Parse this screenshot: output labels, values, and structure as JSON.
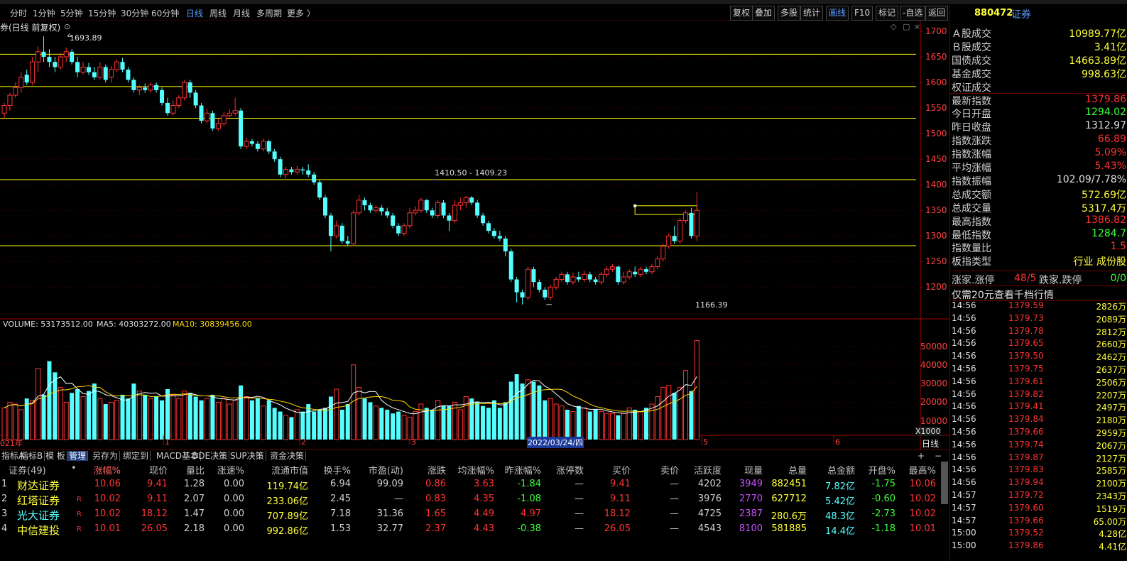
{
  "toolbar": {
    "periods": [
      "分时",
      "1分钟",
      "5分钟",
      "15分钟",
      "30分钟",
      "60分钟",
      "日线",
      "周线",
      "月线",
      "多周期",
      "更多 〉"
    ],
    "active_period": "日线",
    "right_buttons": [
      "复权",
      "叠加",
      "多股",
      "统计",
      "画线",
      "F10",
      "标记",
      "-自选",
      "返回"
    ],
    "active_right": "画线"
  },
  "chart": {
    "title": "券(日线 前复权)",
    "high_label": "1693.89",
    "low_label": "1166.39",
    "range_label": "1410.50 - 1409.23",
    "price_ticks": [
      "1700",
      "1650",
      "1600",
      "1550",
      "1500",
      "1450",
      "1400",
      "1350",
      "1300",
      "1250",
      "1200"
    ],
    "volume_title": "VOLUME: 53173512.00",
    "ma5_label": "MA5: 40303272.00",
    "ma10_label": "MA10: 30839456.00",
    "vol_ticks": [
      "50000",
      "40000",
      "30000",
      "20000",
      "10000"
    ],
    "vol_unit": "X1000",
    "x_labels": [
      "021年",
      "1",
      "2",
      "3",
      "5",
      "6"
    ],
    "cursor_date": "2022/03/24/四",
    "period_tag": "日线",
    "colors": {
      "up": "#ff3232",
      "down": "#54ffff",
      "support": "#ffff00",
      "ma5": "#ffffff",
      "ma10": "#ffd800"
    }
  },
  "chart_data": {
    "type": "candlestick",
    "title": "券(日线 前复权)",
    "support_lines": [
      1655,
      1592,
      1530,
      1410,
      1281
    ],
    "candles": [
      [
        1540,
        1555,
        1530,
        1560
      ],
      [
        1555,
        1575,
        1545,
        1580
      ],
      [
        1575,
        1590,
        1570,
        1600
      ],
      [
        1590,
        1610,
        1580,
        1620
      ],
      [
        1615,
        1600,
        1595,
        1625
      ],
      [
        1600,
        1640,
        1595,
        1650
      ],
      [
        1640,
        1660,
        1620,
        1670
      ],
      [
        1660,
        1650,
        1640,
        1690
      ],
      [
        1650,
        1640,
        1630,
        1665
      ],
      [
        1640,
        1630,
        1620,
        1650
      ],
      [
        1630,
        1650,
        1625,
        1658
      ],
      [
        1650,
        1660,
        1640,
        1668
      ],
      [
        1660,
        1640,
        1635,
        1665
      ],
      [
        1640,
        1620,
        1610,
        1650
      ],
      [
        1620,
        1630,
        1615,
        1640
      ],
      [
        1630,
        1620,
        1615,
        1638
      ],
      [
        1620,
        1610,
        1605,
        1630
      ],
      [
        1610,
        1630,
        1605,
        1640
      ],
      [
        1630,
        1605,
        1600,
        1635
      ],
      [
        1610,
        1625,
        1600,
        1632
      ],
      [
        1625,
        1640,
        1620,
        1645
      ],
      [
        1640,
        1625,
        1620,
        1648
      ],
      [
        1625,
        1605,
        1600,
        1630
      ],
      [
        1605,
        1585,
        1580,
        1610
      ],
      [
        1585,
        1590,
        1575,
        1595
      ],
      [
        1590,
        1585,
        1580,
        1598
      ],
      [
        1585,
        1595,
        1580,
        1600
      ],
      [
        1595,
        1585,
        1580,
        1600
      ],
      [
        1585,
        1560,
        1555,
        1590
      ],
      [
        1560,
        1540,
        1535,
        1570
      ],
      [
        1540,
        1555,
        1535,
        1565
      ],
      [
        1555,
        1570,
        1550,
        1575
      ],
      [
        1570,
        1600,
        1565,
        1605
      ],
      [
        1600,
        1580,
        1570,
        1605
      ],
      [
        1580,
        1555,
        1550,
        1585
      ],
      [
        1555,
        1525,
        1520,
        1560
      ],
      [
        1525,
        1540,
        1520,
        1548
      ],
      [
        1540,
        1510,
        1505,
        1545
      ],
      [
        1510,
        1520,
        1505,
        1530
      ],
      [
        1520,
        1535,
        1515,
        1542
      ],
      [
        1535,
        1540,
        1530,
        1548
      ],
      [
        1540,
        1545,
        1535,
        1570
      ],
      [
        1545,
        1475,
        1470,
        1550
      ],
      [
        1475,
        1485,
        1470,
        1492
      ],
      [
        1485,
        1480,
        1475,
        1490
      ],
      [
        1480,
        1470,
        1465,
        1485
      ],
      [
        1470,
        1485,
        1465,
        1490
      ],
      [
        1485,
        1465,
        1460,
        1488
      ],
      [
        1465,
        1450,
        1445,
        1470
      ],
      [
        1450,
        1420,
        1415,
        1455
      ],
      [
        1420,
        1430,
        1412,
        1435
      ],
      [
        1430,
        1425,
        1420,
        1435
      ],
      [
        1425,
        1430,
        1420,
        1438
      ],
      [
        1430,
        1428,
        1420,
        1435
      ],
      [
        1428,
        1420,
        1415,
        1440
      ],
      [
        1420,
        1405,
        1400,
        1425
      ],
      [
        1405,
        1375,
        1370,
        1410
      ],
      [
        1375,
        1340,
        1335,
        1380
      ],
      [
        1340,
        1300,
        1270,
        1345
      ],
      [
        1300,
        1320,
        1295,
        1330
      ],
      [
        1320,
        1290,
        1285,
        1325
      ],
      [
        1290,
        1285,
        1280,
        1300
      ],
      [
        1285,
        1345,
        1280,
        1350
      ],
      [
        1345,
        1370,
        1340,
        1380
      ],
      [
        1370,
        1360,
        1350,
        1375
      ],
      [
        1360,
        1350,
        1345,
        1365
      ],
      [
        1350,
        1355,
        1345,
        1360
      ],
      [
        1355,
        1348,
        1340,
        1360
      ],
      [
        1348,
        1340,
        1335,
        1355
      ],
      [
        1340,
        1320,
        1315,
        1345
      ],
      [
        1320,
        1305,
        1300,
        1325
      ],
      [
        1305,
        1320,
        1300,
        1325
      ],
      [
        1320,
        1345,
        1315,
        1355
      ],
      [
        1345,
        1350,
        1340,
        1358
      ],
      [
        1350,
        1370,
        1345,
        1375
      ],
      [
        1370,
        1350,
        1345,
        1372
      ],
      [
        1350,
        1340,
        1335,
        1355
      ],
      [
        1340,
        1365,
        1335,
        1370
      ],
      [
        1365,
        1340,
        1335,
        1370
      ],
      [
        1340,
        1330,
        1310,
        1345
      ],
      [
        1330,
        1360,
        1325,
        1370
      ],
      [
        1360,
        1365,
        1350,
        1375
      ],
      [
        1365,
        1375,
        1355,
        1378
      ],
      [
        1375,
        1365,
        1360,
        1378
      ],
      [
        1365,
        1340,
        1335,
        1370
      ],
      [
        1340,
        1325,
        1320,
        1345
      ],
      [
        1325,
        1310,
        1305,
        1330
      ],
      [
        1310,
        1300,
        1295,
        1315
      ],
      [
        1300,
        1295,
        1290,
        1310
      ],
      [
        1295,
        1270,
        1260,
        1300
      ],
      [
        1270,
        1215,
        1210,
        1275
      ],
      [
        1215,
        1190,
        1170,
        1220
      ],
      [
        1190,
        1180,
        1166,
        1195
      ],
      [
        1180,
        1235,
        1175,
        1240
      ],
      [
        1235,
        1210,
        1200,
        1240
      ],
      [
        1210,
        1195,
        1190,
        1215
      ],
      [
        1195,
        1180,
        1175,
        1200
      ],
      [
        1180,
        1200,
        1175,
        1205
      ],
      [
        1200,
        1215,
        1195,
        1220
      ],
      [
        1215,
        1225,
        1210,
        1230
      ],
      [
        1225,
        1210,
        1205,
        1230
      ],
      [
        1210,
        1220,
        1205,
        1228
      ],
      [
        1220,
        1215,
        1210,
        1230
      ],
      [
        1215,
        1225,
        1210,
        1232
      ],
      [
        1225,
        1215,
        1210,
        1230
      ],
      [
        1215,
        1210,
        1205,
        1220
      ],
      [
        1210,
        1225,
        1205,
        1230
      ],
      [
        1225,
        1235,
        1220,
        1240
      ],
      [
        1235,
        1240,
        1230,
        1245
      ],
      [
        1240,
        1210,
        1205,
        1242
      ],
      [
        1210,
        1220,
        1205,
        1230
      ],
      [
        1220,
        1230,
        1215,
        1235
      ],
      [
        1230,
        1225,
        1220,
        1240
      ],
      [
        1225,
        1235,
        1220,
        1240
      ],
      [
        1235,
        1230,
        1225,
        1240
      ],
      [
        1230,
        1240,
        1225,
        1245
      ],
      [
        1240,
        1255,
        1235,
        1260
      ],
      [
        1255,
        1280,
        1250,
        1285
      ],
      [
        1280,
        1300,
        1275,
        1305
      ],
      [
        1300,
        1290,
        1285,
        1320
      ],
      [
        1290,
        1330,
        1285,
        1335
      ],
      [
        1330,
        1345,
        1325,
        1350
      ],
      [
        1345,
        1300,
        1295,
        1355
      ],
      [
        1300,
        1350,
        1290,
        1386
      ]
    ],
    "volumes": [
      17,
      20,
      19,
      16,
      22,
      21,
      38,
      24,
      42,
      36,
      28,
      20,
      25,
      27,
      23,
      26,
      30,
      22,
      19,
      20,
      21,
      24,
      22,
      30,
      26,
      24,
      22,
      23,
      21,
      27,
      24,
      22,
      26,
      25,
      23,
      21,
      22,
      24,
      20,
      22,
      19,
      21,
      29,
      23,
      21,
      22,
      18,
      21,
      17,
      15,
      13,
      12,
      16,
      15,
      19,
      15,
      16,
      17,
      23,
      27,
      16,
      19,
      40,
      28,
      22,
      20,
      18,
      17,
      16,
      14,
      15,
      13,
      12,
      15,
      19,
      17,
      16,
      21,
      18,
      18,
      20,
      16,
      23,
      22,
      20,
      18,
      17,
      21,
      17,
      20,
      31,
      35,
      30,
      32,
      31,
      29,
      21,
      22,
      19,
      18,
      16,
      15,
      18,
      17,
      15,
      16,
      15,
      14,
      14,
      13,
      14,
      17,
      16,
      15,
      17,
      19,
      23,
      28,
      29,
      25,
      28,
      37,
      26,
      53
    ]
  },
  "tabs": [
    "指标A",
    "指标B",
    "模 板",
    "管理",
    "另存为",
    "绑定到",
    "MACD基本",
    "DDE决策",
    "SUP决策",
    "资金决策"
  ],
  "active_tab": "管理",
  "table": {
    "headers": [
      "证券(49)",
      "•",
      "涨幅%",
      "现价",
      "量比",
      "涨速%",
      "流通市值",
      "换手%",
      "市盈(动)",
      "涨跌",
      "均涨幅%",
      "昨涨幅%",
      "涨停数",
      "买价",
      "卖价",
      "活跃度",
      "现量",
      "总量",
      "总金额",
      "开盘%",
      "最高%"
    ],
    "rows": [
      {
        "n": "1",
        "name": "财达证券",
        "flag": "",
        "v": [
          "10.06",
          "9.41",
          "1.28",
          "0.00",
          "119.74亿",
          "6.94",
          "99.09",
          "0.86",
          "3.63",
          "-1.84",
          "—",
          "9.41",
          "—",
          "4202",
          "3949",
          "882451",
          "7.82亿",
          "-1.75",
          "10.06"
        ],
        "name_color": "#ffff3a"
      },
      {
        "n": "2",
        "name": "红塔证券",
        "flag": "R",
        "v": [
          "10.02",
          "9.11",
          "2.07",
          "0.00",
          "233.06亿",
          "2.45",
          "—",
          "0.83",
          "4.35",
          "-1.08",
          "—",
          "9.11",
          "—",
          "3976",
          "2770",
          "627712",
          "5.42亿",
          "-0.60",
          "10.02"
        ],
        "name_color": "#ffff3a"
      },
      {
        "n": "3",
        "name": "光大证券",
        "flag": "R",
        "v": [
          "10.02",
          "18.12",
          "1.47",
          "0.00",
          "707.89亿",
          "7.18",
          "31.36",
          "1.65",
          "4.49",
          "4.97",
          "—",
          "18.12",
          "—",
          "4725",
          "2387",
          "280.6万",
          "48.3亿",
          "-2.73",
          "10.02"
        ],
        "name_color": "#54ffff"
      },
      {
        "n": "4",
        "name": "中信建投",
        "flag": "R",
        "v": [
          "10.01",
          "26.05",
          "2.18",
          "0.00",
          "992.86亿",
          "1.53",
          "32.77",
          "2.37",
          "4.43",
          "-0.38",
          "—",
          "26.05",
          "—",
          "4543",
          "8100",
          "581885",
          "14.4亿",
          "-1.18",
          "10.01"
        ],
        "name_color": "#ffff3a"
      }
    ]
  },
  "right_panel": {
    "code": "880472",
    "name": "证券",
    "stats": [
      {
        "k": "Ａ股成交",
        "v": "10989.77亿",
        "c": "#ffff3a"
      },
      {
        "k": "Ｂ股成交",
        "v": "3.41亿",
        "c": "#ffff3a"
      },
      {
        "k": "国债成交",
        "v": "14663.89亿",
        "c": "#ffff3a"
      },
      {
        "k": "基金成交",
        "v": "998.63亿",
        "c": "#ffff3a"
      },
      {
        "k": "权证成交",
        "v": "",
        "c": "#ffff3a"
      },
      {
        "k": "最新指数",
        "v": "1379.86",
        "c": "#ff3232"
      },
      {
        "k": "今日开盘",
        "v": "1294.02",
        "c": "#3aff3a"
      },
      {
        "k": "昨日收盘",
        "v": "1312.97",
        "c": "#e0e0e0"
      },
      {
        "k": "指数涨跌",
        "v": "66.89",
        "c": "#ff3232"
      },
      {
        "k": "指数涨幅",
        "v": "5.09%",
        "c": "#ff3232"
      },
      {
        "k": "平均涨幅",
        "v": "5.43%",
        "c": "#ff3232"
      },
      {
        "k": "指数振幅",
        "v": "102.09/7.78%",
        "c": "#e0e0e0"
      },
      {
        "k": "总成交额",
        "v": "572.69亿",
        "c": "#ffff3a"
      },
      {
        "k": "总成交量",
        "v": "5317.4万",
        "c": "#ffff3a"
      },
      {
        "k": "最高指数",
        "v": "1386.82",
        "c": "#ff3232"
      },
      {
        "k": "最低指数",
        "v": "1284.7",
        "c": "#3aff3a"
      },
      {
        "k": "指数量比",
        "v": "1.5",
        "c": "#ff3232"
      },
      {
        "k": "板指类型",
        "v": "行业 成份股",
        "c": "#ffff3a"
      }
    ],
    "up_label": "涨家.涨停",
    "up_value": "48/5",
    "down_label": "跌家.跌停",
    "down_value": "0/0",
    "promo": "仅需20元查看千档行情",
    "ticks": [
      [
        "14:56",
        "1379.59",
        "2826万"
      ],
      [
        "14:56",
        "1379.73",
        "2089万"
      ],
      [
        "14:56",
        "1379.78",
        "2812万"
      ],
      [
        "14:56",
        "1379.65",
        "2660万"
      ],
      [
        "14:56",
        "1379.50",
        "2462万"
      ],
      [
        "14:56",
        "1379.75",
        "2637万"
      ],
      [
        "14:56",
        "1379.61",
        "2506万"
      ],
      [
        "14:56",
        "1379.82",
        "2207万"
      ],
      [
        "14:56",
        "1379.41",
        "2497万"
      ],
      [
        "14:56",
        "1379.84",
        "2180万"
      ],
      [
        "14:56",
        "1379.66",
        "2959万"
      ],
      [
        "14:56",
        "1379.74",
        "2067万"
      ],
      [
        "14:56",
        "1379.87",
        "2127万"
      ],
      [
        "14:56",
        "1379.83",
        "2585万"
      ],
      [
        "14:56",
        "1379.94",
        "2100万"
      ],
      [
        "14:57",
        "1379.72",
        "2343万"
      ],
      [
        "14:57",
        "1379.60",
        "1519万"
      ],
      [
        "14:57",
        "1379.66",
        "65.00万"
      ],
      [
        "15:00",
        "1379.52",
        "4.28亿"
      ],
      [
        "15:00",
        "1379.86",
        "4.41亿"
      ]
    ]
  }
}
